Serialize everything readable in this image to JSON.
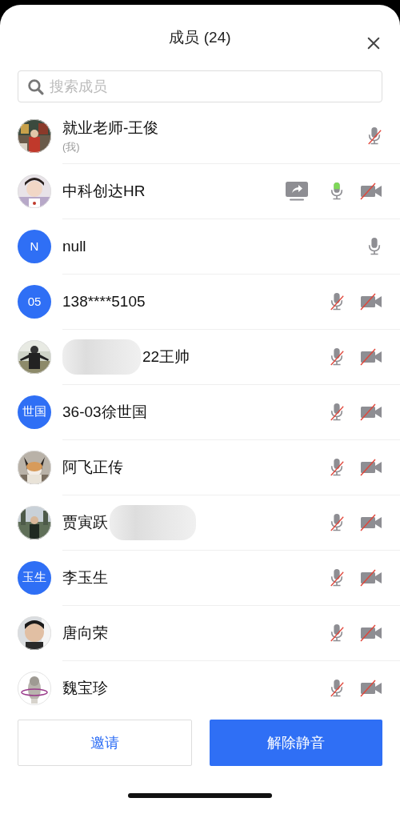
{
  "header": {
    "title": "成员 (24)"
  },
  "search": {
    "placeholder": "搜索成员"
  },
  "members": [
    {
      "name": "就业老师-王俊",
      "subtitle": "(我)",
      "mic_muted": true,
      "speaking": false
    },
    {
      "name": "中科创达HR",
      "sharing": true,
      "mic_muted": false,
      "speaking": true,
      "camera_off": true
    },
    {
      "name": "null",
      "avatar": {
        "kind": "initials",
        "text": "N"
      },
      "mic_muted": false,
      "speaking": false
    },
    {
      "name": "138****5105",
      "avatar": {
        "kind": "initials",
        "text": "05"
      },
      "mic_muted": true,
      "speaking": false,
      "camera_off": true
    },
    {
      "name": "22王帅",
      "redacted_before": true,
      "mic_muted": true,
      "speaking": false,
      "camera_off": true
    },
    {
      "name": "36-03徐世国",
      "avatar": {
        "kind": "initials",
        "text": "世国"
      },
      "mic_muted": true,
      "speaking": false,
      "camera_off": true
    },
    {
      "name": "阿飞正传",
      "mic_muted": true,
      "speaking": false,
      "camera_off": true
    },
    {
      "name": "贾寅跃",
      "redacted_after": true,
      "mic_muted": true,
      "speaking": false,
      "camera_off": true
    },
    {
      "name": "李玉生",
      "avatar": {
        "kind": "initials",
        "text": "玉生"
      },
      "mic_muted": true,
      "speaking": false,
      "camera_off": true
    },
    {
      "name": "唐向荣",
      "mic_muted": true,
      "speaking": false,
      "camera_off": true
    },
    {
      "name": "魏宝珍",
      "mic_muted": true,
      "speaking": false,
      "camera_off": true
    }
  ],
  "buttons": [
    {
      "label": "邀请",
      "kind": "secondary"
    },
    {
      "label": "解除静音",
      "kind": "primary"
    }
  ]
}
